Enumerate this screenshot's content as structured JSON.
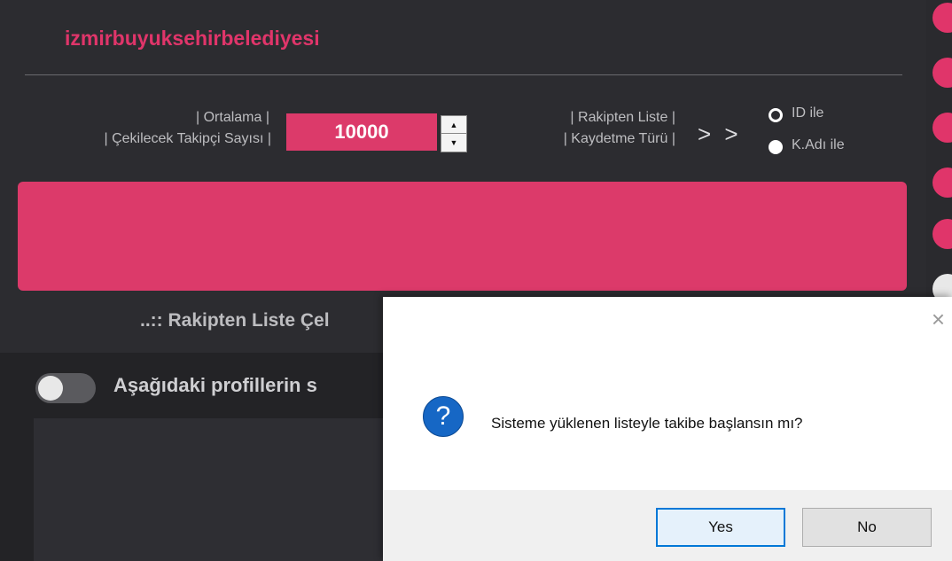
{
  "app": {
    "title": "izmirbuyuksehirbelediyesi",
    "follower_count": {
      "label_line1": "| Ortalama |",
      "label_line2": "| Çekilecek Takipçi Sayısı |",
      "value": "10000"
    },
    "save_type": {
      "label_line1": "| Rakipten Liste |",
      "label_line2": "| Kaydetme Türü |",
      "arrows": "> >",
      "options": [
        "ID ile",
        "K.Adı ile"
      ],
      "selected": "ID ile"
    },
    "status_text": "..:: Rakipten Liste Çel",
    "toggle_label": "Aşağıdaki profillerin s",
    "side_dot_colors": [
      "#e0356a",
      "#e0356a",
      "#e0356a",
      "#e0356a",
      "#e0356a",
      "#e8e8e8",
      "#e8e8e8"
    ]
  },
  "dialog": {
    "message": "Sisteme yüklenen listeyle takibe başlansın mı?",
    "icon": "question-icon",
    "close_glyph": "×",
    "yes_label": "Yes",
    "no_label": "No"
  },
  "colors": {
    "accent": "#dc3a6a",
    "dialog_primary_border": "#0078d7"
  }
}
